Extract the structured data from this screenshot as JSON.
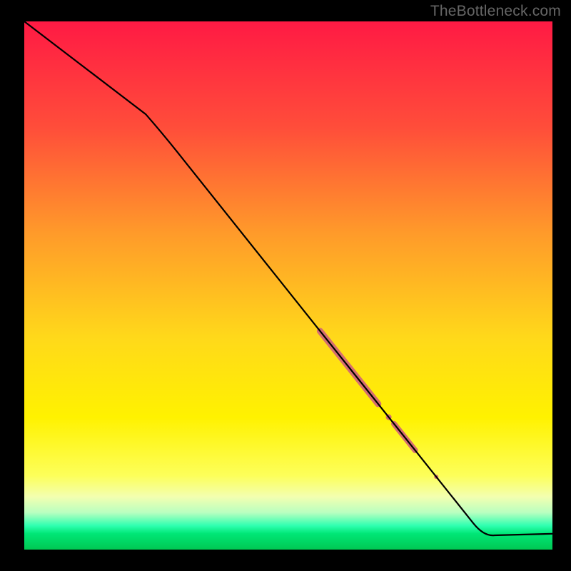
{
  "watermark": "TheBottleneck.com",
  "chart_data": {
    "type": "line",
    "title": "",
    "xlabel": "",
    "ylabel": "",
    "xlim": [
      0,
      100
    ],
    "ylim": [
      0,
      100
    ],
    "series": [
      {
        "name": "curve",
        "points": [
          {
            "x": 0,
            "y": 100
          },
          {
            "x": 26,
            "y": 79
          },
          {
            "x": 87,
            "y": 2.5
          },
          {
            "x": 100,
            "y": 3
          }
        ],
        "color": "#000000"
      }
    ],
    "markers": [
      {
        "name": "segment-1",
        "x_start": 56,
        "x_end": 67,
        "color": "#d56f6f",
        "weight": 9
      },
      {
        "name": "dot-1",
        "x": 69,
        "color": "#d56f6f",
        "weight": 8
      },
      {
        "name": "segment-2",
        "x_start": 70,
        "x_end": 74,
        "color": "#d56f6f",
        "weight": 8
      },
      {
        "name": "dot-2",
        "x": 78,
        "color": "#d56f6f",
        "weight": 6
      }
    ],
    "gradient_stops": [
      {
        "offset": 0,
        "color": "#ff1a44"
      },
      {
        "offset": 20,
        "color": "#ff4d3a"
      },
      {
        "offset": 40,
        "color": "#ff9a2a"
      },
      {
        "offset": 60,
        "color": "#ffd91a"
      },
      {
        "offset": 75,
        "color": "#fff200"
      },
      {
        "offset": 86,
        "color": "#fdff5a"
      },
      {
        "offset": 90,
        "color": "#f3ffb0"
      },
      {
        "offset": 93,
        "color": "#b9ffc0"
      },
      {
        "offset": 95.5,
        "color": "#2dffb0"
      },
      {
        "offset": 97,
        "color": "#00e676"
      },
      {
        "offset": 100,
        "color": "#00c853"
      }
    ]
  }
}
